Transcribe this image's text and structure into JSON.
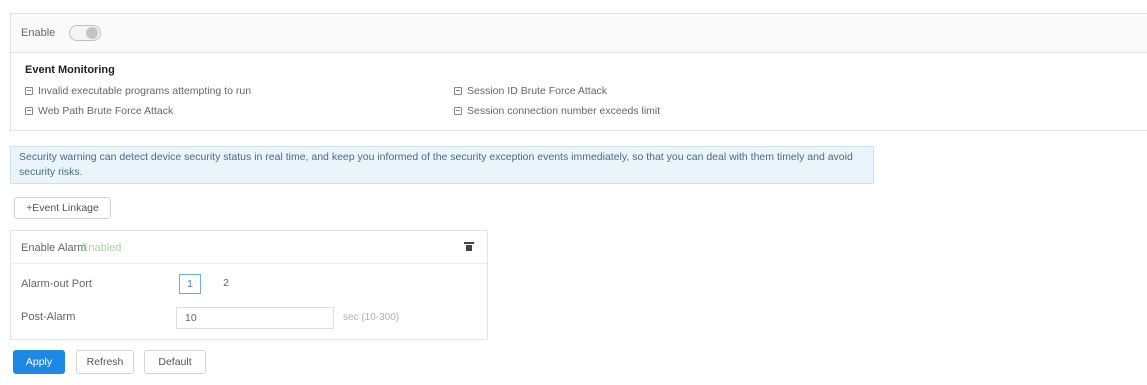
{
  "enable": {
    "label": "Enable",
    "on": false
  },
  "event_monitoring": {
    "title": "Event Monitoring",
    "items": [
      {
        "label": "Invalid executable programs attempting to run"
      },
      {
        "label": "Session ID Brute Force Attack"
      },
      {
        "label": "Web Path Brute Force Attack"
      },
      {
        "label": "Session connection number exceeds limit"
      }
    ]
  },
  "info_text": "Security warning can detect device security status in real time, and keep you informed of the security exception events immediately, so that you can deal with them timely and avoid security risks.",
  "event_linkage_label": "+Event Linkage",
  "alarm_card": {
    "title": "Enable Alarm",
    "status": "Enabled",
    "alarm_out_port_label": "Alarm-out Port",
    "ports": [
      "1",
      "2"
    ],
    "selected_port": "1",
    "post_alarm_label": "Post-Alarm",
    "post_alarm_value": "10",
    "post_alarm_unit": "sec (10-300)"
  },
  "footer": {
    "apply": "Apply",
    "refresh": "Refresh",
    "default": "Default"
  },
  "colors": {
    "primary": "#1e88e5",
    "info_bg": "#eaf5fb",
    "enabled_green": "#9fd6a8"
  }
}
